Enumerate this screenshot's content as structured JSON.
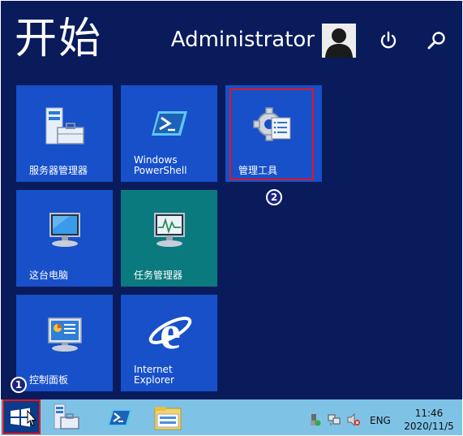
{
  "start_screen": {
    "title": "开始",
    "user_name": "Administrator",
    "icons": {
      "power": "power-icon",
      "search": "search-icon",
      "avatar": "user-avatar-icon"
    }
  },
  "tiles": [
    {
      "label": "服务器管理器",
      "icon": "server-manager-icon",
      "color": "#1750c9"
    },
    {
      "label": "Windows\nPowerShell",
      "icon": "powershell-icon",
      "color": "#1750c9"
    },
    {
      "label": "管理工具",
      "icon": "administrative-tools-icon",
      "color": "#1750c9"
    },
    {
      "label": "这台电脑",
      "icon": "this-pc-icon",
      "color": "#1750c9"
    },
    {
      "label": "任务管理器",
      "icon": "task-manager-icon",
      "color": "#0a7a7e"
    },
    {
      "label": "控制面板",
      "icon": "control-panel-icon",
      "color": "#1750c9"
    },
    {
      "label": "Internet\nExplorer",
      "icon": "internet-explorer-icon",
      "color": "#1750c9"
    }
  ],
  "annotations": {
    "step1": "1",
    "step2": "2",
    "highlight_color": "#e4161c"
  },
  "taskbar": {
    "pinned": [
      "start-button",
      "server-manager-icon",
      "powershell-icon",
      "file-explorer-icon"
    ],
    "tray": {
      "language": "ENG",
      "time": "11:46",
      "date": "2020/11/5"
    }
  }
}
